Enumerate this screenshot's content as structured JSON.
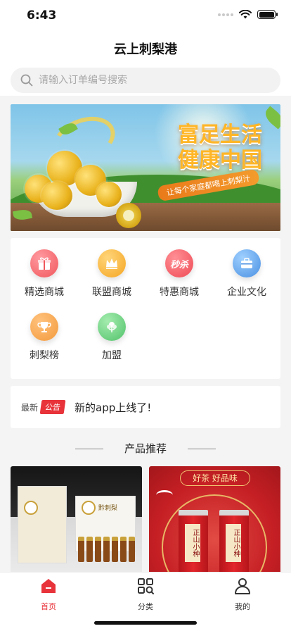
{
  "status_bar": {
    "time": "6:43",
    "icons": [
      "signal-icon",
      "wifi-icon",
      "battery-icon"
    ]
  },
  "header": {
    "title": "云上刺梨港"
  },
  "search": {
    "placeholder": "请输入订单编号搜索",
    "value": ""
  },
  "banner": {
    "headline_line1": "富足生活",
    "headline_line2": "健康中国",
    "ribbon": "让每个家庭都喝上刺梨汁"
  },
  "menu": {
    "items": [
      {
        "label": "精选商城",
        "icon": "gift-icon",
        "color": "#f0575c"
      },
      {
        "label": "联盟商城",
        "icon": "crown-icon",
        "color": "#f5a623"
      },
      {
        "label": "特惠商城",
        "icon": "seckill-icon",
        "color": "#ef4b55",
        "icon_text": "秒杀"
      },
      {
        "label": "企业文化",
        "icon": "briefcase-icon",
        "color": "#4a90e2"
      },
      {
        "label": "刺梨榜",
        "icon": "trophy-icon",
        "color": "#f39a3c"
      },
      {
        "label": "加盟",
        "icon": "flower-icon",
        "color": "#52c26b"
      }
    ]
  },
  "notice": {
    "latest": "最新",
    "tag": "公告",
    "text": "新的app上线了!"
  },
  "products_section": {
    "title": "产品推荐"
  },
  "products": [
    {
      "name": "cili-gift-set",
      "logo_text": "黔刺梨"
    },
    {
      "name": "zhengshan-xiaozhong-tea",
      "slogan": "好茶 好品味",
      "can_text": "正山小种"
    }
  ],
  "tabbar": {
    "tabs": [
      {
        "label": "首页",
        "icon": "home-icon",
        "active": true
      },
      {
        "label": "分类",
        "icon": "category-icon",
        "active": false
      },
      {
        "label": "我的",
        "icon": "user-icon",
        "active": false
      }
    ]
  },
  "colors": {
    "accent": "#e8333a",
    "background": "#f4f4f4"
  }
}
